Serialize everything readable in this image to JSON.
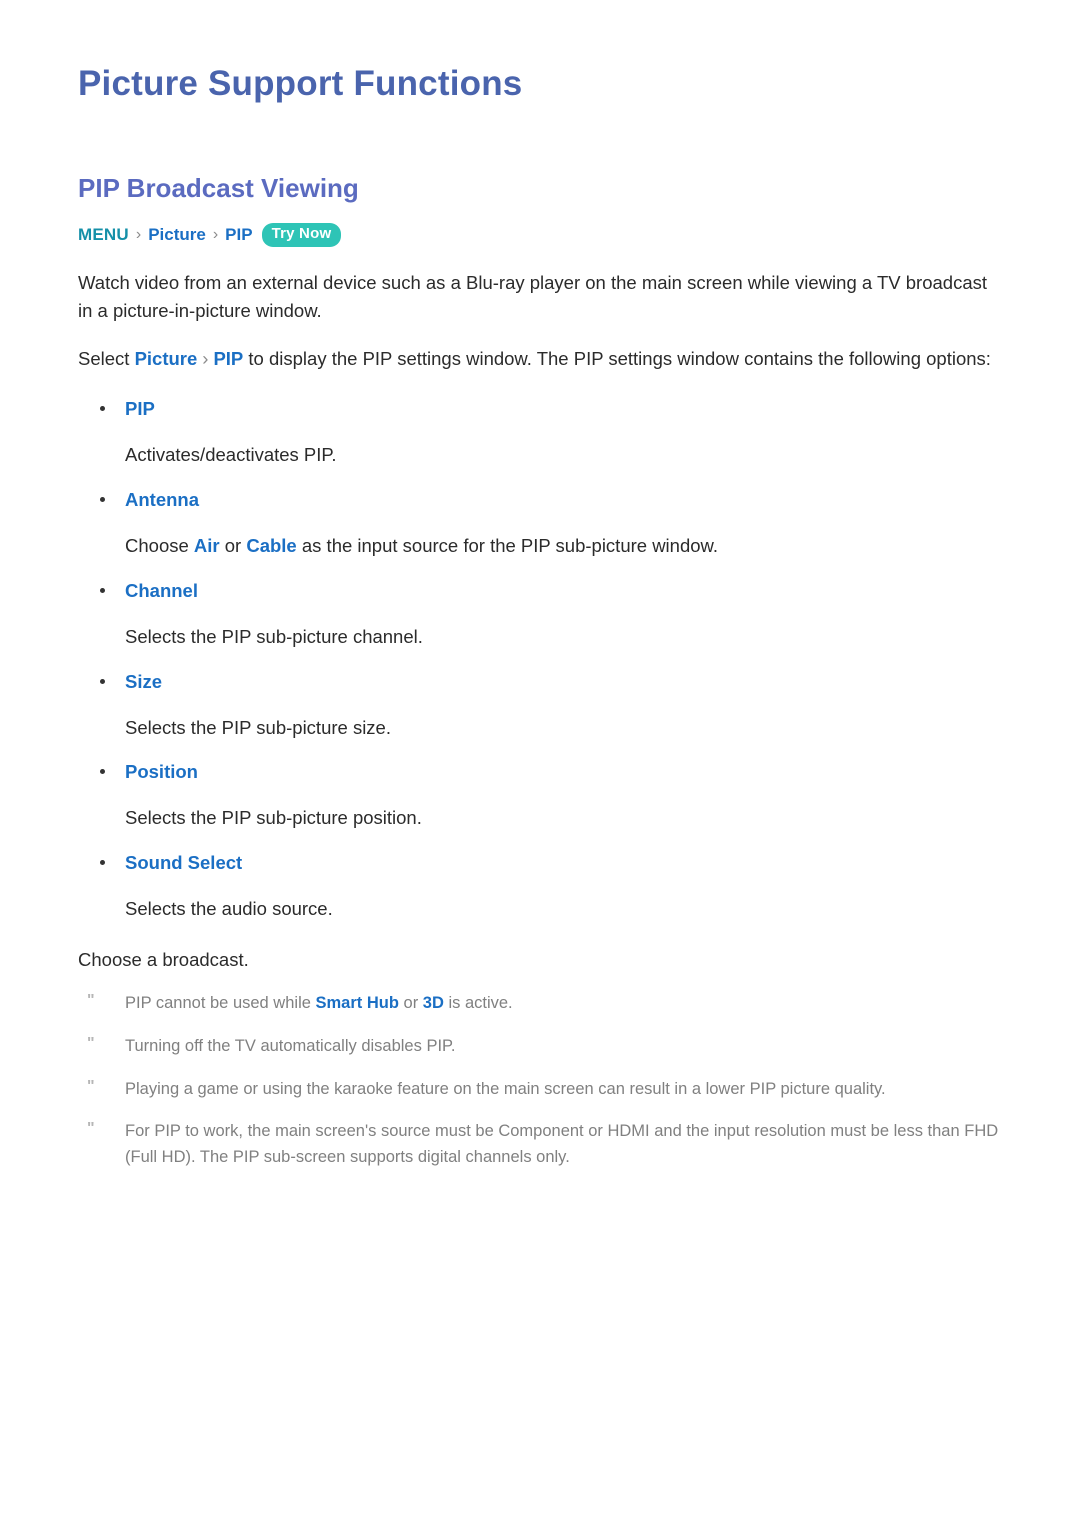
{
  "page": {
    "title": "Picture Support Functions",
    "section_title": "PIP Broadcast Viewing"
  },
  "breadcrumb": {
    "root": "MENU",
    "separator": "›",
    "items": [
      "Picture",
      "PIP"
    ],
    "badge": "Try Now"
  },
  "intro": {
    "paragraph1": "Watch video from an external device such as a Blu-ray player on the main screen while viewing a TV broadcast in a picture-in-picture window.",
    "p2_prefix": "Select ",
    "p2_link1": "Picture",
    "p2_sep": "›",
    "p2_link2": "PIP",
    "p2_suffix": " to display the PIP settings window. The PIP settings window contains the following options:"
  },
  "options": [
    {
      "label": "PIP",
      "desc": "Activates/deactivates PIP."
    },
    {
      "label": "Antenna",
      "desc_prefix": "Choose ",
      "desc_link1": "Air",
      "desc_mid": " or ",
      "desc_link2": "Cable",
      "desc_suffix": " as the input source for the PIP sub-picture window."
    },
    {
      "label": "Channel",
      "desc": "Selects the PIP sub-picture channel."
    },
    {
      "label": "Size",
      "desc": "Selects the PIP sub-picture size."
    },
    {
      "label": "Position",
      "desc": "Selects the PIP sub-picture position."
    },
    {
      "label": "Sound Select",
      "desc": "Selects the audio source."
    }
  ],
  "closing": "Choose a broadcast.",
  "notes": {
    "marker": "\"",
    "items": [
      {
        "prefix": "PIP cannot be used while ",
        "link1": "Smart Hub",
        "mid": " or ",
        "link2": "3D",
        "suffix": " is active."
      },
      {
        "text": "Turning off the TV automatically disables PIP."
      },
      {
        "text": "Playing a game or using the karaoke feature on the main screen can result in a lower PIP picture quality."
      },
      {
        "text": "For PIP to work, the main screen's source must be Component or HDMI and the input resolution must be less than FHD (Full HD). The PIP sub-screen supports digital channels only."
      }
    ]
  },
  "colors": {
    "page_title": "#4a64ad",
    "section_title": "#5b6bc0",
    "link_blue": "#1b6fc4",
    "menu_teal": "#1590a8",
    "badge_teal": "#2ec4b6",
    "body_text": "#2b2b2b",
    "note_text": "#808080"
  }
}
